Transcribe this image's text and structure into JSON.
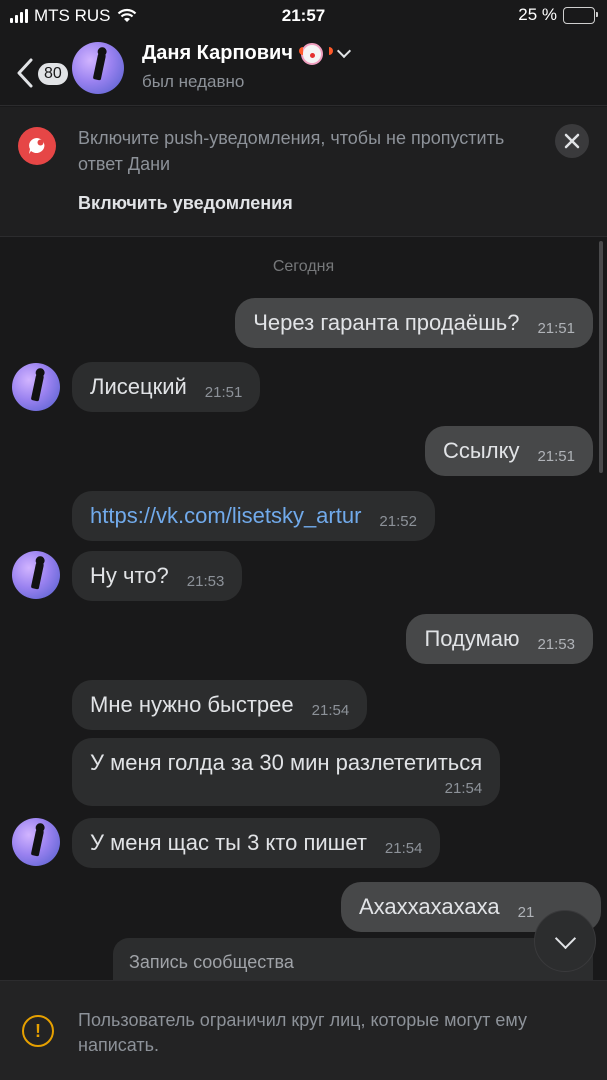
{
  "status_bar": {
    "carrier": "MTS RUS",
    "time": "21:57",
    "battery_percent_label": "25 %",
    "battery_level": 0.25
  },
  "header": {
    "unread_count": "80",
    "contact_name": "Даня Карпович",
    "contact_status": "был недавно"
  },
  "notice": {
    "text": "Включите push-уведомления, чтобы не пропустить ответ Дани",
    "action_label": "Включить уведомления"
  },
  "chat": {
    "date_separator": "Сегодня",
    "messages": [
      {
        "direction": "out",
        "text": "Через гаранта продаёшь?",
        "time": "21:51"
      },
      {
        "direction": "in",
        "text": "Лисецкий",
        "time": "21:51"
      },
      {
        "direction": "out",
        "text": "Ссылку",
        "time": "21:51"
      },
      {
        "direction": "in",
        "text": "https://vk.com/lisetsky_artur",
        "time": "21:52"
      },
      {
        "direction": "in",
        "text": "Ну что?",
        "time": "21:53"
      },
      {
        "direction": "out",
        "text": "Подумаю",
        "time": "21:53"
      },
      {
        "direction": "in",
        "text": "Мне нужно быстрее",
        "time": "21:54"
      },
      {
        "direction": "in",
        "text": "У меня голда за 30 мин разлететиться",
        "time": "21:54"
      },
      {
        "direction": "in",
        "text": "У меня щас ты 3 кто пишет",
        "time": "21:54"
      },
      {
        "direction": "out",
        "text": "Ахаххахахаха",
        "time": "21"
      }
    ],
    "community_post_label": "Запись сообщества"
  },
  "restriction": {
    "text": "Пользователь ограничил круг лиц, которые могут ему написать."
  },
  "colors": {
    "background": "#19191a",
    "incoming_bubble": "#2c2d2e",
    "outgoing_bubble": "#474849",
    "link": "#71aaeb",
    "notice_icon": "#e64646",
    "warning": "#e6a000",
    "battery": "#f5d110"
  },
  "icons": {
    "back": "chevron-left-icon",
    "notice": "chat-bubble-icon",
    "close": "close-icon",
    "dropdown": "chevron-down-icon",
    "scroll_down": "chevron-down-icon",
    "warning": "exclamation-circle-icon"
  }
}
